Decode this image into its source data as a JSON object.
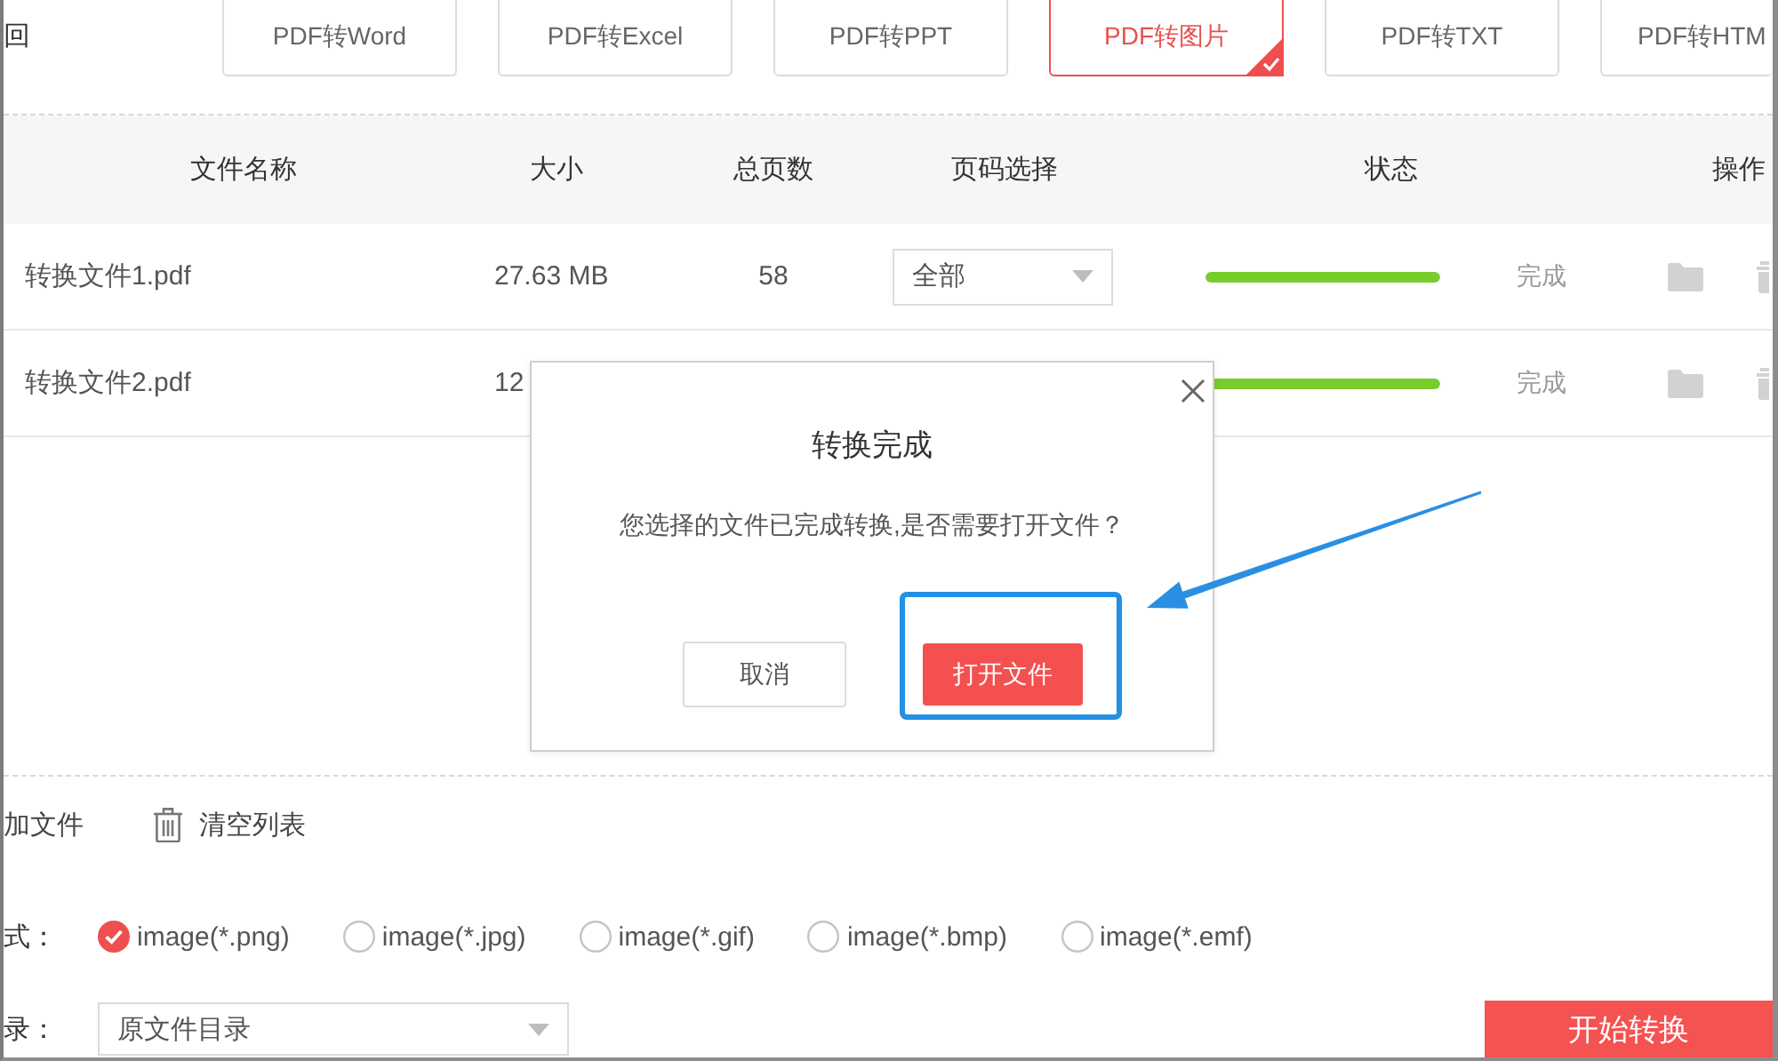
{
  "toolbar": {
    "back_label": "回",
    "tabs": [
      {
        "label": "PDF转Word",
        "selected": false
      },
      {
        "label": "PDF转Excel",
        "selected": false
      },
      {
        "label": "PDF转PPT",
        "selected": false
      },
      {
        "label": "PDF转图片",
        "selected": true
      },
      {
        "label": "PDF转TXT",
        "selected": false
      },
      {
        "label": "PDF转HTM",
        "selected": false
      }
    ]
  },
  "table": {
    "columns": [
      "文件名称",
      "大小",
      "总页数",
      "页码选择",
      "状态",
      "操作"
    ],
    "rows": [
      {
        "name": "转换文件1.pdf",
        "size": "27.63 MB",
        "pages": "58",
        "page_range": "全部",
        "level": 1,
        "status": "完成"
      },
      {
        "name": "转换文件2.pdf",
        "size": "12",
        "level": 1,
        "status": "完成"
      }
    ]
  },
  "actions": [
    {
      "kind": "add",
      "label": "加文件"
    },
    {
      "kind": "clear",
      "label": "清空列表"
    }
  ],
  "format": {
    "label": "式：",
    "options": [
      {
        "label": "image(*.png)",
        "selected": true
      },
      {
        "label": "image(*.jpg)",
        "selected": false
      },
      {
        "label": "image(*.gif)",
        "selected": false
      },
      {
        "label": "image(*.bmp)",
        "selected": false
      },
      {
        "label": "image(*.emf)",
        "selected": false
      }
    ]
  },
  "output": {
    "label": "录：",
    "value": "原文件目录"
  },
  "start_button": "开始转换",
  "dialog": {
    "title": "转换完成",
    "message": "您选择的文件已完成转换,是否需要打开文件？",
    "buttons": [
      {
        "kind": "cancel",
        "label": "取消"
      },
      {
        "kind": "primary",
        "label": "打开文件"
      }
    ]
  }
}
